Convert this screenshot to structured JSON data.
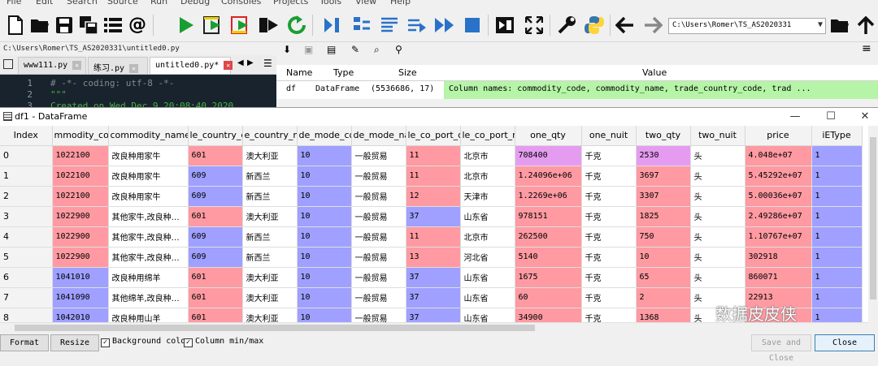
{
  "menu": [
    "File",
    "Edit",
    "Search",
    "Source",
    "Run",
    "Debug",
    "Consoles",
    "Projects",
    "Tools",
    "View",
    "Help"
  ],
  "toolbar": {
    "icons": [
      "new-file-icon",
      "open-folder-icon",
      "save-icon",
      "save-all-icon",
      "outline-icon",
      "at-icon",
      "run-icon",
      "run-cell-icon",
      "run-cell-advance-icon",
      "run-selection-icon",
      "rerun-icon",
      "debug-step-icon",
      "step-into-icon",
      "step-return-icon",
      "continue-icon",
      "stop-icon",
      "maximize-pane-icon",
      "fullscreen-icon",
      "preferences-icon",
      "python-path-icon",
      "back-icon",
      "forward-icon"
    ],
    "path": "C:\\Users\\Romer\\TS_AS2020331"
  },
  "editor": {
    "path": "C:\\Users\\Romer\\TS_AS2020331\\untitled0.py",
    "tabs": [
      {
        "label": "www111.py",
        "active": false
      },
      {
        "label": "练习.py",
        "active": false
      },
      {
        "label": "untitled0.py*",
        "active": true
      }
    ],
    "lines": [
      {
        "num": "1",
        "text": "# -*- coding: utf-8 -*-",
        "kind": "comment"
      },
      {
        "num": "2",
        "text": "\"\"\"",
        "kind": "str"
      },
      {
        "num": "3",
        "text": "Created on Wed Dec  9 20:08:40 2020",
        "kind": "str"
      }
    ]
  },
  "variable_explorer": {
    "headers": {
      "name": "Name",
      "type": "Type",
      "size": "Size",
      "value": "Value"
    },
    "row": {
      "name": "df",
      "type": "DataFrame",
      "size": "(5536686, 17)",
      "value": "Column names: commodity_code, commodity_name, trade_country_code, trad ..."
    }
  },
  "dataframe_window": {
    "title": "df1 - DataFrame",
    "columns": [
      "Index",
      "mmodity_co",
      "commodity_name",
      "le_country_c",
      "e_country_na",
      "de_mode_co",
      "de_mode_na",
      "le_co_port_c",
      "le_co_port_na",
      "one_qty",
      "one_nuit",
      "two_qty",
      "two_nuit",
      "price",
      "iEType"
    ],
    "rows": [
      [
        "0",
        "1022100",
        "改良种用家牛",
        "601",
        "澳大利亚",
        "10",
        "一般贸易",
        "11",
        "北京市",
        "708400",
        "千克",
        "2530",
        "头",
        "4.048e+07",
        "1"
      ],
      [
        "1",
        "1022100",
        "改良种用家牛",
        "609",
        "新西兰",
        "10",
        "一般贸易",
        "11",
        "北京市",
        "1.24096e+06",
        "千克",
        "3697",
        "头",
        "5.45292e+07",
        "1"
      ],
      [
        "2",
        "1022100",
        "改良种用家牛",
        "609",
        "新西兰",
        "10",
        "一般贸易",
        "12",
        "天津市",
        "1.2269e+06",
        "千克",
        "3307",
        "头",
        "5.00036e+07",
        "1"
      ],
      [
        "3",
        "1022900",
        "其他家牛,改良种…",
        "601",
        "澳大利亚",
        "10",
        "一般贸易",
        "37",
        "山东省",
        "978151",
        "千克",
        "1825",
        "头",
        "2.49286e+07",
        "1"
      ],
      [
        "4",
        "1022900",
        "其他家牛,改良种…",
        "609",
        "新西兰",
        "10",
        "一般贸易",
        "11",
        "北京市",
        "262500",
        "千克",
        "750",
        "头",
        "1.10767e+07",
        "1"
      ],
      [
        "5",
        "1022900",
        "其他家牛,改良种…",
        "609",
        "新西兰",
        "10",
        "一般贸易",
        "13",
        "河北省",
        "5140",
        "千克",
        "10",
        "头",
        "302918",
        "1"
      ],
      [
        "6",
        "1041010",
        "改良种用绵羊",
        "601",
        "澳大利亚",
        "10",
        "一般贸易",
        "37",
        "山东省",
        "1675",
        "千克",
        "65",
        "头",
        "860071",
        "1"
      ],
      [
        "7",
        "1041090",
        "其他绵羊,改良种…",
        "601",
        "澳大利亚",
        "10",
        "一般贸易",
        "37",
        "山东省",
        "60",
        "千克",
        "2",
        "头",
        "22913",
        "1"
      ],
      [
        "8",
        "1042010",
        "改良种用山羊",
        "601",
        "澳大利亚",
        "10",
        "一般贸易",
        "37",
        "山东省",
        "34900",
        "千克",
        "1368",
        "头",
        "",
        "1"
      ]
    ],
    "cell_colors": [
      [
        "",
        "#ff9aa2",
        "",
        "#ff9aa2",
        "",
        "#9fa0ff",
        "",
        "#ff9aa2",
        "",
        "#e59cf0",
        "",
        "#e59cf0",
        "",
        "#ff9aa2",
        "#9fa0ff"
      ],
      [
        "",
        "#ff9aa2",
        "",
        "#9fa0ff",
        "",
        "#9fa0ff",
        "",
        "#ff9aa2",
        "",
        "#ff9aa2",
        "",
        "#ff9aa2",
        "",
        "#ff9aa2",
        "#9fa0ff"
      ],
      [
        "",
        "#ff9aa2",
        "",
        "#9fa0ff",
        "",
        "#9fa0ff",
        "",
        "#ff9aa2",
        "",
        "#ff9aa2",
        "",
        "#ff9aa2",
        "",
        "#ff9aa2",
        "#9fa0ff"
      ],
      [
        "",
        "#ff9aa2",
        "",
        "#ff9aa2",
        "",
        "#9fa0ff",
        "",
        "#9fa0ff",
        "",
        "#ff9aa2",
        "",
        "#ff9aa2",
        "",
        "#ff9aa2",
        "#9fa0ff"
      ],
      [
        "",
        "#ff9aa2",
        "",
        "#9fa0ff",
        "",
        "#9fa0ff",
        "",
        "#ff9aa2",
        "",
        "#ff9aa2",
        "",
        "#ff9aa2",
        "",
        "#ff9aa2",
        "#9fa0ff"
      ],
      [
        "",
        "#ff9aa2",
        "",
        "#9fa0ff",
        "",
        "#9fa0ff",
        "",
        "#ff9aa2",
        "",
        "#ff9aa2",
        "",
        "#ff9aa2",
        "",
        "#ff9aa2",
        "#9fa0ff"
      ],
      [
        "",
        "#9fa0ff",
        "",
        "#ff9aa2",
        "",
        "#9fa0ff",
        "",
        "#9fa0ff",
        "",
        "#ff9aa2",
        "",
        "#ff9aa2",
        "",
        "#ff9aa2",
        "#9fa0ff"
      ],
      [
        "",
        "#9fa0ff",
        "",
        "#ff9aa2",
        "",
        "#9fa0ff",
        "",
        "#9fa0ff",
        "",
        "#ff9aa2",
        "",
        "#ff9aa2",
        "",
        "#ff9aa2",
        "#9fa0ff"
      ],
      [
        "",
        "#9fa0ff",
        "",
        "#ff9aa2",
        "",
        "#9fa0ff",
        "",
        "#9fa0ff",
        "",
        "#ff9aa2",
        "",
        "#ff9aa2",
        "",
        "#ff9aa2",
        "#9fa0ff"
      ]
    ],
    "buttons": {
      "format": "Format",
      "resize": "Resize",
      "save_close": "Save and Close",
      "close": "Close"
    },
    "checkboxes": {
      "background_color": "Background color",
      "column_minmax": "Column min/max"
    },
    "watermark": "数据皮皮侠"
  }
}
